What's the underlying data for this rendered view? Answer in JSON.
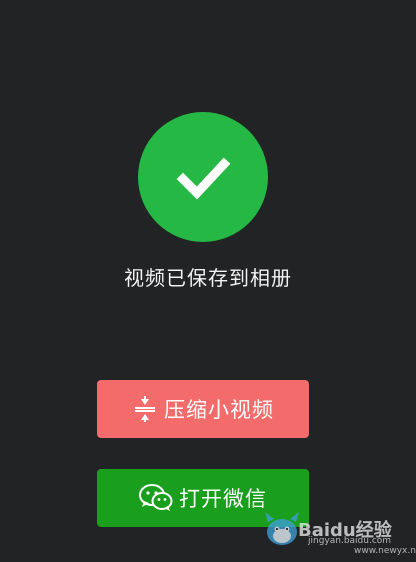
{
  "status": {
    "icon": "checkmark-icon",
    "message": "视频已保存到相册",
    "color": "#26b845"
  },
  "buttons": {
    "compress": {
      "label": "压缩小视频",
      "icon": "compress-icon",
      "color": "#f36b6b"
    },
    "open_wechat": {
      "label": "打开微信",
      "icon": "wechat-icon",
      "color": "#1a9e1d"
    }
  },
  "watermark": {
    "brand": "Baidu经验",
    "line1": "jingyan.baidu.com",
    "line2": "www.newyx.net"
  }
}
